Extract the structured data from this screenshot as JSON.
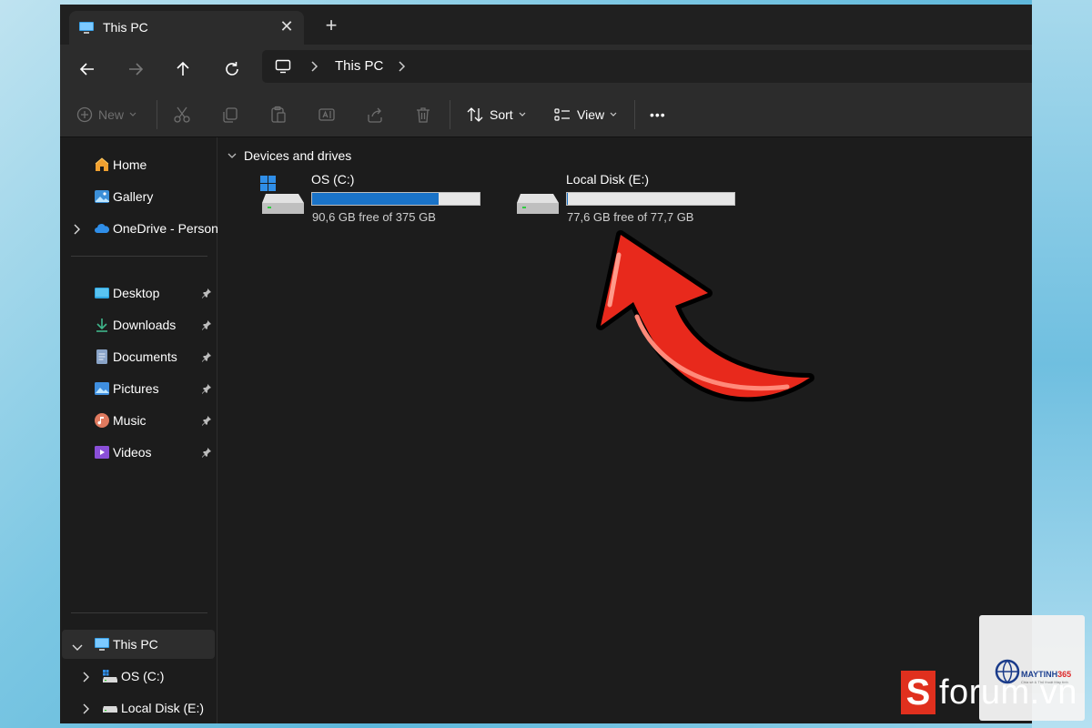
{
  "window": {
    "tab_title": "This PC",
    "close_glyph": "✕",
    "new_tab_glyph": "+"
  },
  "address_bar": {
    "location": "This PC"
  },
  "toolbar": {
    "new_label": "New",
    "sort_label": "Sort",
    "view_label": "View",
    "more_glyph": "•••"
  },
  "sidebar": {
    "quick": [
      {
        "label": "Home",
        "icon": "home-icon"
      },
      {
        "label": "Gallery",
        "icon": "gallery-icon"
      },
      {
        "label": "OneDrive - Persona",
        "icon": "onedrive-icon"
      }
    ],
    "pinned": [
      {
        "label": "Desktop",
        "icon": "desktop-folder-icon"
      },
      {
        "label": "Downloads",
        "icon": "downloads-icon"
      },
      {
        "label": "Documents",
        "icon": "documents-icon"
      },
      {
        "label": "Pictures",
        "icon": "pictures-icon"
      },
      {
        "label": "Music",
        "icon": "music-icon"
      },
      {
        "label": "Videos",
        "icon": "videos-icon"
      }
    ],
    "tree": [
      {
        "label": "This PC",
        "icon": "pc-icon"
      },
      {
        "label": "OS (C:)",
        "icon": "drive-c-icon"
      },
      {
        "label": "Local Disk (E:)",
        "icon": "drive-icon"
      }
    ]
  },
  "content": {
    "group_title": "Devices and drives",
    "drives": [
      {
        "name": "OS (C:)",
        "free_text": "90,6 GB free of 375 GB",
        "used_fraction": 0.758,
        "fill_color": "#1a73c8"
      },
      {
        "name": "Local Disk (E:)",
        "free_text": "77,6 GB free of 77,7 GB",
        "used_fraction": 0.0013,
        "fill_color": "#1a73c8"
      }
    ]
  },
  "watermarks": {
    "brand_name_a": "MAYTINH",
    "brand_name_b": "365",
    "brand_tagline": "Chia sẻ & Thủ thuật Máy tính",
    "forum_letter": "S",
    "forum_text": "forum.vn"
  },
  "colors": {
    "accent": "#1a73c8",
    "arrow": "#e8291c",
    "forum_red": "#e0301e"
  }
}
